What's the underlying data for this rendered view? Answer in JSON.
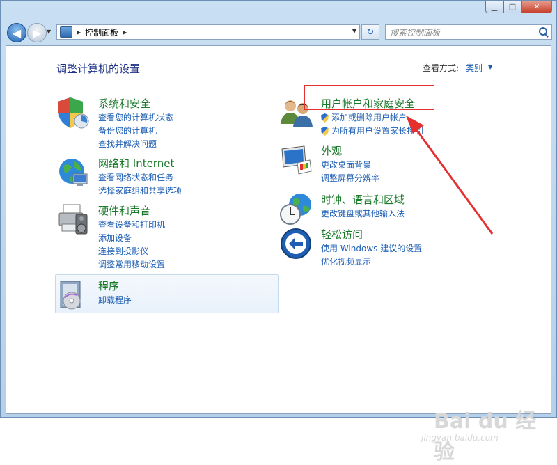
{
  "window": {
    "minimize": "▁",
    "maximize": "□",
    "close": "✕"
  },
  "nav": {
    "back": "◀",
    "forward": "▶",
    "breadcrumb": "控制面板",
    "search_placeholder": "搜索控制面板",
    "refresh": "↻"
  },
  "main": {
    "heading": "调整计算机的设置",
    "view_by_label": "查看方式:",
    "view_by_value": "类别"
  },
  "categories": {
    "system": {
      "title": "系统和安全",
      "links": [
        "查看您的计算机状态",
        "备份您的计算机",
        "查找并解决问题"
      ]
    },
    "network": {
      "title": "网络和 Internet",
      "links": [
        "查看网络状态和任务",
        "选择家庭组和共享选项"
      ]
    },
    "hardware": {
      "title": "硬件和声音",
      "links": [
        "查看设备和打印机",
        "添加设备",
        "连接到投影仪",
        "调整常用移动设置"
      ]
    },
    "programs": {
      "title": "程序",
      "links": [
        "卸载程序"
      ]
    },
    "users": {
      "title": "用户帐户和家庭安全",
      "links": [
        "添加或删除用户帐户",
        "为所有用户设置家长控制"
      ]
    },
    "appearance": {
      "title": "外观",
      "links": [
        "更改桌面背景",
        "调整屏幕分辨率"
      ]
    },
    "clock": {
      "title": "时钟、语言和区域",
      "links": [
        "更改键盘或其他输入法"
      ]
    },
    "ease": {
      "title": "轻松访问",
      "links": [
        "使用 Windows 建议的设置",
        "优化视频显示"
      ]
    }
  },
  "watermark": {
    "brand": "Bai du 经验",
    "url": "jingyan.baidu.com"
  },
  "colors": {
    "link": "#1e5fb4",
    "category_title": "#1a7a2a",
    "heading": "#1e3287",
    "annotation": "#e53030"
  }
}
